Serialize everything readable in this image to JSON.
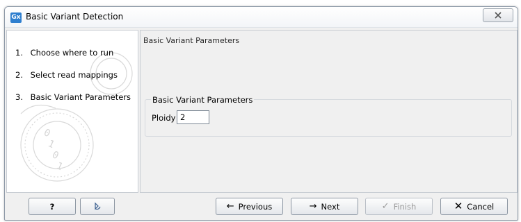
{
  "window": {
    "app_icon": "Gx",
    "title": "Basic Variant Detection",
    "close_glyph": "☒"
  },
  "steps": [
    {
      "num": "1.",
      "label": "Choose where to run"
    },
    {
      "num": "2.",
      "label": "Select read mappings"
    },
    {
      "num": "3.",
      "label": "Basic Variant Parameters"
    }
  ],
  "main": {
    "title": "Basic Variant Parameters",
    "group_label": "Basic Variant Parameters",
    "ploidy_label": "Ploidy",
    "ploidy_value": "2"
  },
  "buttons": {
    "help": "?",
    "reset_icon": "reset-icon",
    "previous": "Previous",
    "next": "Next",
    "finish": "Finish",
    "cancel": "Cancel"
  }
}
